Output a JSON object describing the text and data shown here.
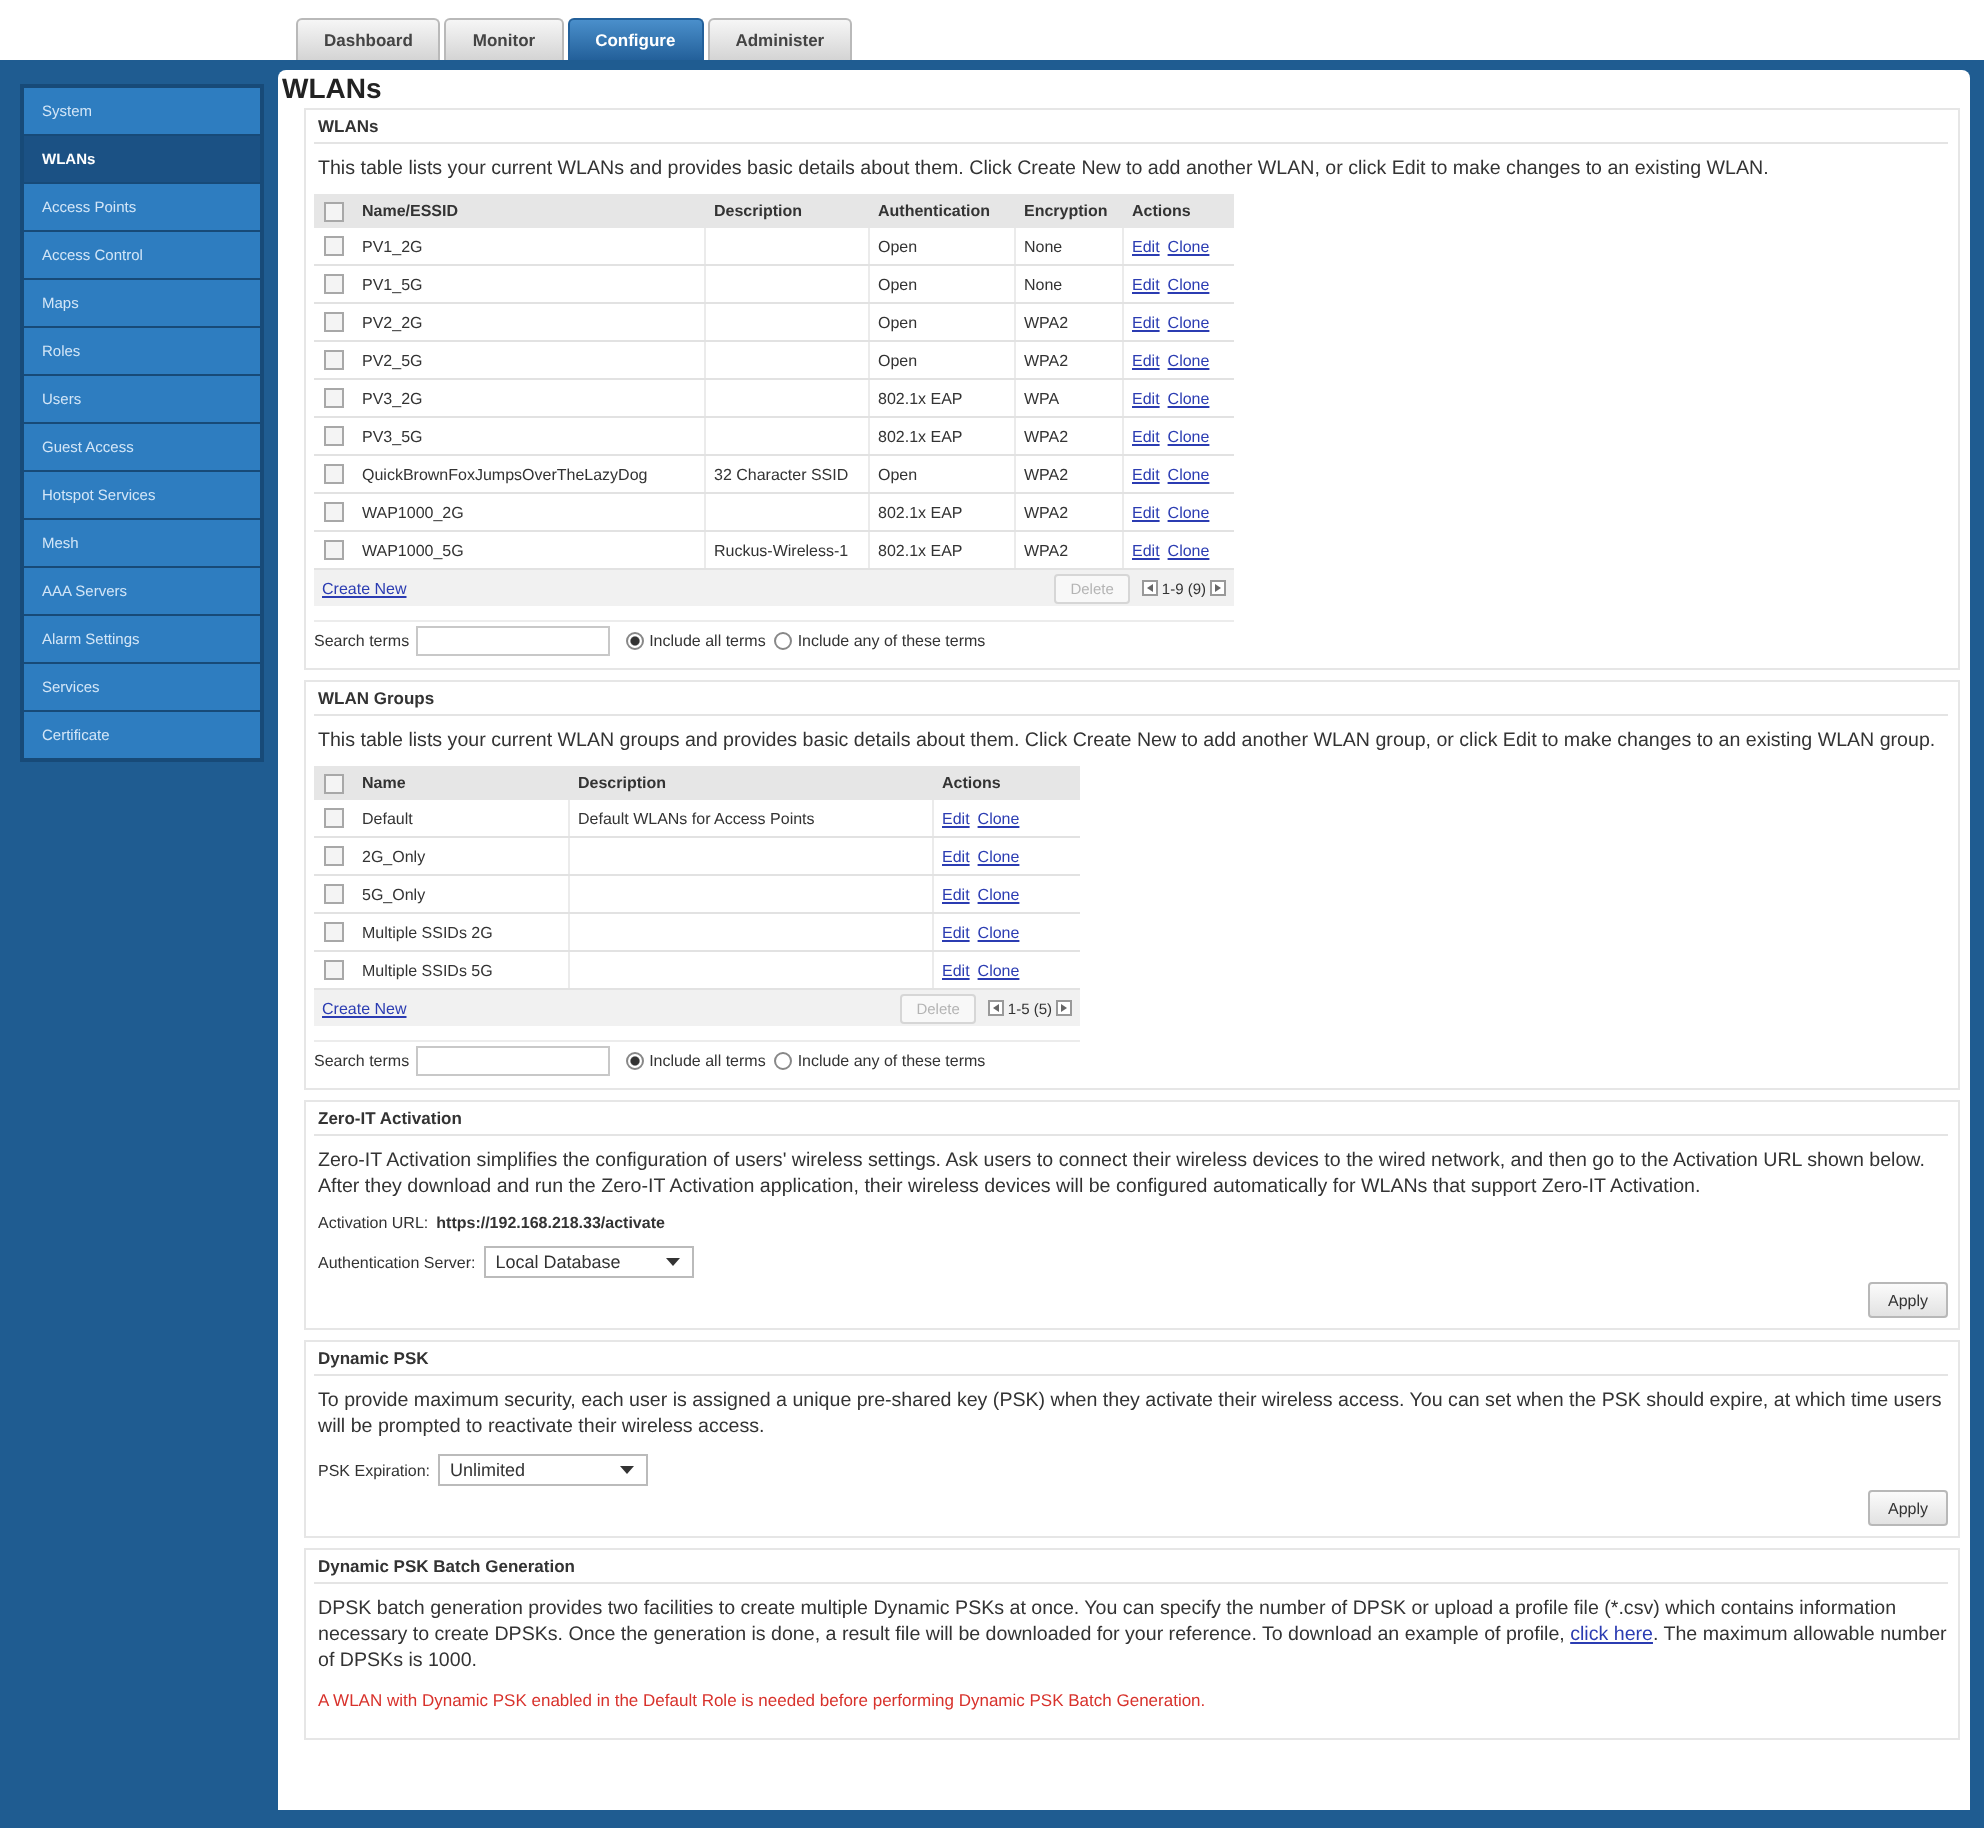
{
  "tabs": [
    {
      "label": "Dashboard",
      "selected": false
    },
    {
      "label": "Monitor",
      "selected": false
    },
    {
      "label": "Configure",
      "selected": true
    },
    {
      "label": "Administer",
      "selected": false
    }
  ],
  "sidebar": {
    "items": [
      {
        "label": "System",
        "selected": false
      },
      {
        "label": "WLANs",
        "selected": true
      },
      {
        "label": "Access Points",
        "selected": false
      },
      {
        "label": "Access Control",
        "selected": false
      },
      {
        "label": "Maps",
        "selected": false
      },
      {
        "label": "Roles",
        "selected": false
      },
      {
        "label": "Users",
        "selected": false
      },
      {
        "label": "Guest Access",
        "selected": false
      },
      {
        "label": "Hotspot Services",
        "selected": false
      },
      {
        "label": "Mesh",
        "selected": false
      },
      {
        "label": "AAA Servers",
        "selected": false
      },
      {
        "label": "Alarm Settings",
        "selected": false
      },
      {
        "label": "Services",
        "selected": false
      },
      {
        "label": "Certificate",
        "selected": false
      }
    ]
  },
  "page_title": "WLANs",
  "wlans": {
    "heading": "WLANs",
    "description": "This table lists your current WLANs and provides basic details about them. Click Create New to add another WLAN, or click Edit to make changes to an existing WLAN.",
    "header_checked": false,
    "columns": [
      "Name/ESSID",
      "Description",
      "Authentication",
      "Encryption",
      "Actions"
    ],
    "rows": [
      {
        "checked": false,
        "name": "PV1_2G",
        "authentication": "Open",
        "encryption": "None",
        "actions": [
          "Edit",
          "Clone"
        ]
      },
      {
        "checked": false,
        "name": "PV1_5G",
        "authentication": "Open",
        "encryption": "None",
        "actions": [
          "Edit",
          "Clone"
        ]
      },
      {
        "checked": false,
        "name": "PV2_2G",
        "authentication": "Open",
        "encryption": "WPA2",
        "actions": [
          "Edit",
          "Clone"
        ]
      },
      {
        "checked": false,
        "name": "PV2_5G",
        "authentication": "Open",
        "encryption": "WPA2",
        "actions": [
          "Edit",
          "Clone"
        ]
      },
      {
        "checked": false,
        "name": "PV3_2G",
        "authentication": "802.1x EAP",
        "encryption": "WPA",
        "actions": [
          "Edit",
          "Clone"
        ]
      },
      {
        "checked": false,
        "name": "PV3_5G",
        "authentication": "802.1x EAP",
        "encryption": "WPA2",
        "actions": [
          "Edit",
          "Clone"
        ]
      },
      {
        "checked": false,
        "name": "QuickBrownFoxJumpsOverTheLazyDog",
        "description": "32 Character SSID",
        "authentication": "Open",
        "encryption": "WPA2",
        "actions": [
          "Edit",
          "Clone"
        ]
      },
      {
        "checked": false,
        "name": "WAP1000_2G",
        "authentication": "802.1x EAP",
        "encryption": "WPA2",
        "actions": [
          "Edit",
          "Clone"
        ]
      },
      {
        "checked": false,
        "name": "WAP1000_5G",
        "description": "Ruckus-Wireless-1",
        "authentication": "802.1x EAP",
        "encryption": "WPA2",
        "actions": [
          "Edit",
          "Clone"
        ]
      }
    ],
    "create_new": "Create New",
    "delete_button": {
      "label": "Delete",
      "disabled": true
    },
    "pagination": "1-9 (9)",
    "search": {
      "label": "Search terms",
      "options": [
        {
          "label": "Include all terms",
          "selected": true
        },
        {
          "label": "Include any of these terms",
          "selected": false
        }
      ]
    }
  },
  "wlan_groups": {
    "heading": "WLAN Groups",
    "description": "This table lists your current WLAN groups and provides basic details about them. Click Create New to add another WLAN group, or click Edit to make changes to an existing WLAN group.",
    "header_checked": false,
    "columns": [
      "Name",
      "Description",
      "Actions"
    ],
    "rows": [
      {
        "checked": false,
        "name": "Default",
        "description": "Default WLANs for Access Points",
        "actions": [
          "Edit",
          "Clone"
        ]
      },
      {
        "checked": false,
        "name": "2G_Only",
        "actions": [
          "Edit",
          "Clone"
        ]
      },
      {
        "checked": false,
        "name": "5G_Only",
        "actions": [
          "Edit",
          "Clone"
        ]
      },
      {
        "checked": false,
        "name": "Multiple SSIDs 2G",
        "actions": [
          "Edit",
          "Clone"
        ]
      },
      {
        "checked": false,
        "name": "Multiple SSIDs 5G",
        "actions": [
          "Edit",
          "Clone"
        ]
      }
    ],
    "create_new": "Create New",
    "delete_button": {
      "label": "Delete",
      "disabled": true
    },
    "pagination": "1-5 (5)",
    "search": {
      "label": "Search terms",
      "options": [
        {
          "label": "Include all terms",
          "selected": true
        },
        {
          "label": "Include any of these terms",
          "selected": false
        }
      ]
    }
  },
  "zero_it": {
    "heading": "Zero-IT Activation",
    "description": "Zero-IT Activation simplifies the configuration of users' wireless settings. Ask users to connect their wireless devices to the wired network, and then go to the Activation URL shown below. After they download and run the Zero-IT Activation application, their wireless devices will be configured automatically for WLANs that support Zero-IT Activation.",
    "activation_url": {
      "label": "Activation URL:",
      "value": "https://192.168.218.33/activate"
    },
    "auth_server": {
      "label": "Authentication Server:",
      "value": "Local Database"
    },
    "apply": "Apply"
  },
  "dynamic_psk": {
    "heading": "Dynamic PSK",
    "description": "To provide maximum security, each user is assigned a unique pre-shared key (PSK) when they activate their wireless access. You can set when the PSK should expire, at which time users will be prompted to reactivate their wireless access.",
    "psk_expiration": {
      "label": "PSK Expiration:",
      "value": "Unlimited"
    },
    "apply": "Apply"
  },
  "batch_generation": {
    "heading": "Dynamic PSK Batch Generation",
    "description": [
      {
        "kind": "text",
        "text": "DPSK batch generation provides two facilities to create multiple Dynamic PSKs at once. You can specify the number of DPSK or upload a profile file (*.csv) which contains information necessary to create DPSKs. Once the generation is done, a result file will be downloaded for your reference. To download an example of profile, "
      },
      {
        "kind": "link",
        "text": "click here"
      },
      {
        "kind": "text",
        "text": ". The maximum allowable number of DPSKs is 1000."
      }
    ],
    "warning": "A WLAN with Dynamic PSK enabled in the Default Role is needed before performing Dynamic PSK Batch Generation."
  }
}
